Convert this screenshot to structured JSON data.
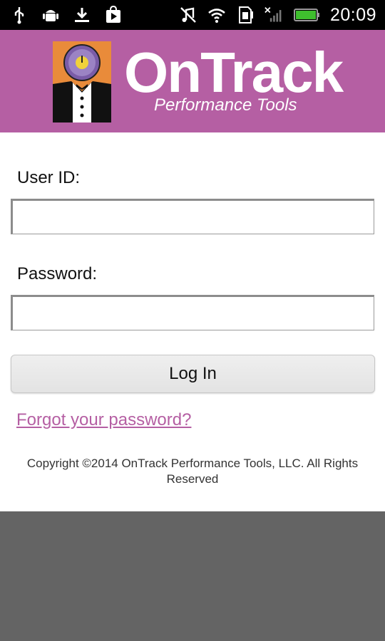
{
  "status_bar": {
    "time": "20:09",
    "left_icons": [
      "usb-icon",
      "android-debug-icon",
      "download-icon",
      "play-store-icon"
    ],
    "right_icons": [
      "no-music-icon",
      "wifi-icon",
      "sd-card-icon",
      "no-signal-icon",
      "battery-icon"
    ]
  },
  "header": {
    "brand_name": "OnTrack",
    "tagline": "Performance Tools",
    "colors": {
      "banner": "#b55fa3",
      "mascot_bg": "#e98b3a",
      "clock_face": "#7a5ca8"
    }
  },
  "form": {
    "user_id_label": "User ID:",
    "user_id_value": "",
    "password_label": "Password:",
    "password_value": "",
    "login_button": "Log In",
    "forgot_link": "Forgot your password?"
  },
  "footer": {
    "copyright_line1": "Copyright ©2014 OnTrack Performance Tools, LLC. All Rights",
    "copyright_line2": "Reserved"
  }
}
